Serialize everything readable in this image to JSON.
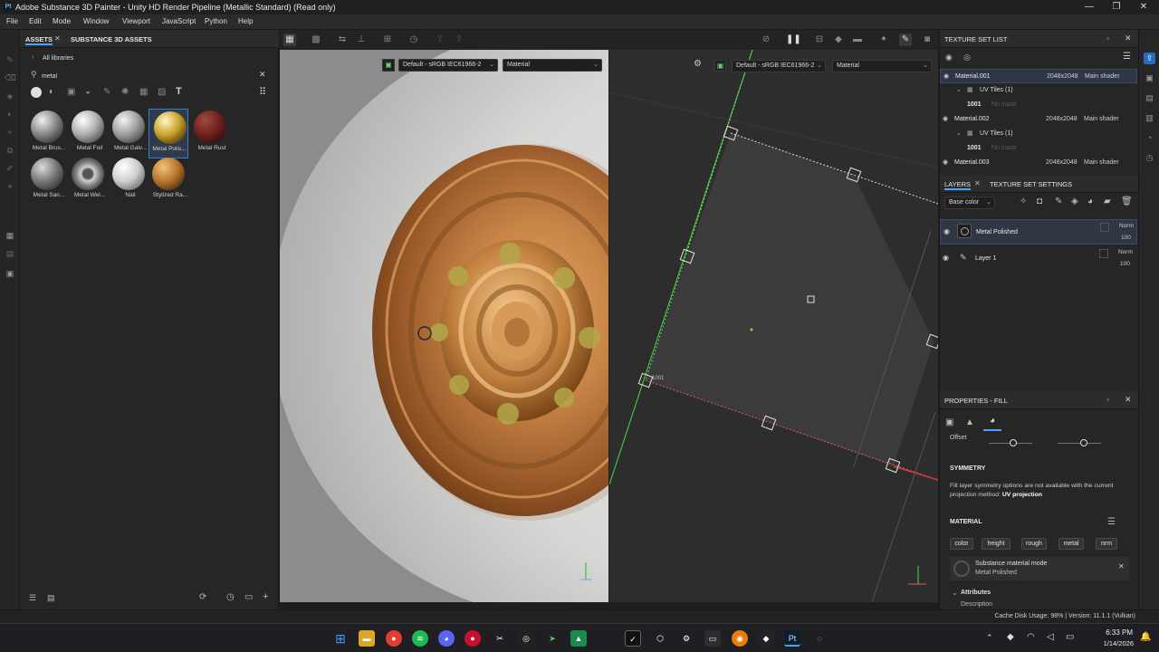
{
  "window": {
    "title": "Adobe Substance 3D Painter - Unity HD Render Pipeline (Metallic Standard) (Read only)",
    "logo": "Pt"
  },
  "menu": [
    "File",
    "Edit",
    "Mode",
    "Window",
    "Viewport",
    "JavaScript",
    "Python",
    "Help"
  ],
  "assets_panel": {
    "tab_assets": "ASSETS",
    "tab_substance": "SUBSTANCE 3D ASSETS",
    "library": "All libraries",
    "search_value": "metal",
    "materials": [
      {
        "label": "Metal Brus...",
        "color": "#9a9a9a"
      },
      {
        "label": "Metal Foil",
        "color": "#b8b8b8"
      },
      {
        "label": "Metal Galv...",
        "color": "#a6a6a6"
      },
      {
        "label": "Metal Polis...",
        "color": "#c9a227"
      },
      {
        "label": "Metal Rust",
        "color": "#6a1f1a"
      },
      {
        "label": "Metal San...",
        "color": "#8c8c8c"
      },
      {
        "label": "Metal Wel...",
        "color": "#7d7d7d"
      },
      {
        "label": "Nail",
        "color": "#d6d6d6"
      },
      {
        "label": "Stylized Ra...",
        "color": "#b8782f"
      }
    ]
  },
  "viewport": {
    "colorspace_3d": "Default - sRGB IEC61966-2",
    "channel_3d": "Material",
    "colorspace_2d": "Default - sRGB IEC61966-2",
    "channel_2d": "Material",
    "uv_tile_label": "1001"
  },
  "texture_set_list": {
    "title": "TEXTURE SET LIST",
    "items": [
      {
        "name": "Material.001",
        "size": "2048x2048",
        "shader": "Main shader",
        "uv": "UV Tiles (1)",
        "tile": "1001",
        "no_mask": "No mask"
      },
      {
        "name": "Material.002",
        "size": "2048x2048",
        "shader": "Main shader",
        "uv": "UV Tiles (1)",
        "tile": "1001",
        "no_mask": "No mask"
      },
      {
        "name": "Material.003",
        "size": "2048x2048",
        "shader": "Main shader"
      }
    ]
  },
  "layers": {
    "tab_layers": "LAYERS",
    "tab_tss": "TEXTURE SET SETTINGS",
    "channel": "Base color",
    "items": [
      {
        "name": "Metal Polished",
        "blend": "Norm",
        "opacity": "100"
      },
      {
        "name": "Layer 1",
        "blend": "Norm",
        "opacity": "100"
      }
    ]
  },
  "properties": {
    "title": "PROPERTIES - FILL",
    "offset_label": "Offset",
    "symmetry_title": "SYMMETRY",
    "symmetry_text": "Fill layer symmetry options are not available with the current projection method:",
    "symmetry_method": "UV projection",
    "material_title": "MATERIAL",
    "chips": [
      "color",
      "height",
      "rough",
      "metal",
      "nrm"
    ],
    "mode_label": "Substance material mode",
    "mode_value": "Metal Polished",
    "attributes": "Attributes",
    "description": "Description"
  },
  "status": {
    "text": "Cache Disk Usage:  98% | Version: 11.1.1 (Vulkan)"
  },
  "clock": {
    "time": "6:33 PM",
    "date": "1/14/2026"
  }
}
